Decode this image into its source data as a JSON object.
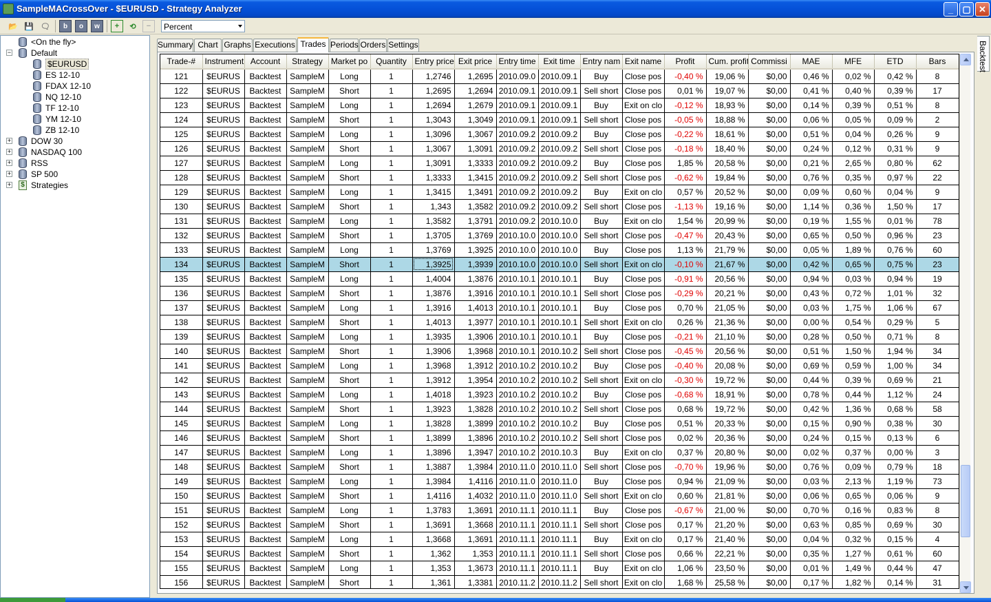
{
  "window": {
    "title": "SampleMACrossOver - $EURUSD - Strategy Analyzer",
    "minimize": "_",
    "maximize": "▢",
    "close": "✕"
  },
  "toolbar": {
    "display_unit": "Percent",
    "buttons": [
      "open-icon",
      "save-icon",
      "chat-icon",
      "b",
      "o",
      "w",
      "add-icon",
      "refresh-icon",
      "remove-icon"
    ]
  },
  "tree": {
    "items": [
      {
        "label": "<On the fly>",
        "indent": 1,
        "expander": "",
        "icon": "database-icon"
      },
      {
        "label": "Default",
        "indent": 0,
        "expander": "−",
        "icon": "database-icon"
      },
      {
        "label": "$EURUSD",
        "indent": 2,
        "expander": "",
        "icon": "database-icon",
        "selected": true
      },
      {
        "label": "ES 12-10",
        "indent": 2,
        "expander": "",
        "icon": "database-icon"
      },
      {
        "label": "FDAX 12-10",
        "indent": 2,
        "expander": "",
        "icon": "database-icon"
      },
      {
        "label": "NQ 12-10",
        "indent": 2,
        "expander": "",
        "icon": "database-icon"
      },
      {
        "label": "TF 12-10",
        "indent": 2,
        "expander": "",
        "icon": "database-icon"
      },
      {
        "label": "YM 12-10",
        "indent": 2,
        "expander": "",
        "icon": "database-icon"
      },
      {
        "label": "ZB 12-10",
        "indent": 2,
        "expander": "",
        "icon": "database-icon"
      },
      {
        "label": "DOW 30",
        "indent": 0,
        "expander": "+",
        "icon": "database-icon"
      },
      {
        "label": "NASDAQ 100",
        "indent": 0,
        "expander": "+",
        "icon": "database-icon"
      },
      {
        "label": "RSS",
        "indent": 0,
        "expander": "+",
        "icon": "database-icon"
      },
      {
        "label": "SP 500",
        "indent": 0,
        "expander": "+",
        "icon": "database-icon"
      },
      {
        "label": "Strategies",
        "indent": 0,
        "expander": "+",
        "icon": "strategy-icon"
      }
    ]
  },
  "tabs": [
    "Summary",
    "Chart",
    "Graphs",
    "Executions",
    "Trades",
    "Periods",
    "Orders",
    "Settings"
  ],
  "active_tab": "Trades",
  "side_tab": "Backtest",
  "grid": {
    "columns": [
      "Trade-#",
      "Instrument",
      "Account",
      "Strategy",
      "Market po",
      "Quantity",
      "Entry price",
      "Exit price",
      "Entry time",
      "Exit time",
      "Entry nam",
      "Exit name",
      "Profit",
      "Cum. profit",
      "Commissi",
      "MAE",
      "MFE",
      "ETD",
      "Bars"
    ],
    "selected_trade": "134",
    "rows": [
      [
        "121",
        "$EURUS",
        "Backtest",
        "SampleM",
        "Long",
        "1",
        "1,2746",
        "1,2695",
        "2010.09.0",
        "2010.09.1",
        "Buy",
        "Close pos",
        "-0,40 %",
        "19,06 %",
        "$0,00",
        "0,46 %",
        "0,02 %",
        "0,42 %",
        "8"
      ],
      [
        "122",
        "$EURUS",
        "Backtest",
        "SampleM",
        "Short",
        "1",
        "1,2695",
        "1,2694",
        "2010.09.1",
        "2010.09.1",
        "Sell short",
        "Close pos",
        "0,01 %",
        "19,07 %",
        "$0,00",
        "0,41 %",
        "0,40 %",
        "0,39 %",
        "17"
      ],
      [
        "123",
        "$EURUS",
        "Backtest",
        "SampleM",
        "Long",
        "1",
        "1,2694",
        "1,2679",
        "2010.09.1",
        "2010.09.1",
        "Buy",
        "Exit on clo",
        "-0,12 %",
        "18,93 %",
        "$0,00",
        "0,14 %",
        "0,39 %",
        "0,51 %",
        "8"
      ],
      [
        "124",
        "$EURUS",
        "Backtest",
        "SampleM",
        "Short",
        "1",
        "1,3043",
        "1,3049",
        "2010.09.1",
        "2010.09.1",
        "Sell short",
        "Close pos",
        "-0,05 %",
        "18,88 %",
        "$0,00",
        "0,06 %",
        "0,05 %",
        "0,09 %",
        "2"
      ],
      [
        "125",
        "$EURUS",
        "Backtest",
        "SampleM",
        "Long",
        "1",
        "1,3096",
        "1,3067",
        "2010.09.2",
        "2010.09.2",
        "Buy",
        "Close pos",
        "-0,22 %",
        "18,61 %",
        "$0,00",
        "0,51 %",
        "0,04 %",
        "0,26 %",
        "9"
      ],
      [
        "126",
        "$EURUS",
        "Backtest",
        "SampleM",
        "Short",
        "1",
        "1,3067",
        "1,3091",
        "2010.09.2",
        "2010.09.2",
        "Sell short",
        "Close pos",
        "-0,18 %",
        "18,40 %",
        "$0,00",
        "0,24 %",
        "0,12 %",
        "0,31 %",
        "9"
      ],
      [
        "127",
        "$EURUS",
        "Backtest",
        "SampleM",
        "Long",
        "1",
        "1,3091",
        "1,3333",
        "2010.09.2",
        "2010.09.2",
        "Buy",
        "Close pos",
        "1,85 %",
        "20,58 %",
        "$0,00",
        "0,21 %",
        "2,65 %",
        "0,80 %",
        "62"
      ],
      [
        "128",
        "$EURUS",
        "Backtest",
        "SampleM",
        "Short",
        "1",
        "1,3333",
        "1,3415",
        "2010.09.2",
        "2010.09.2",
        "Sell short",
        "Close pos",
        "-0,62 %",
        "19,84 %",
        "$0,00",
        "0,76 %",
        "0,35 %",
        "0,97 %",
        "22"
      ],
      [
        "129",
        "$EURUS",
        "Backtest",
        "SampleM",
        "Long",
        "1",
        "1,3415",
        "1,3491",
        "2010.09.2",
        "2010.09.2",
        "Buy",
        "Exit on clo",
        "0,57 %",
        "20,52 %",
        "$0,00",
        "0,09 %",
        "0,60 %",
        "0,04 %",
        "9"
      ],
      [
        "130",
        "$EURUS",
        "Backtest",
        "SampleM",
        "Short",
        "1",
        "1,343",
        "1,3582",
        "2010.09.2",
        "2010.09.2",
        "Sell short",
        "Close pos",
        "-1,13 %",
        "19,16 %",
        "$0,00",
        "1,14 %",
        "0,36 %",
        "1,50 %",
        "17"
      ],
      [
        "131",
        "$EURUS",
        "Backtest",
        "SampleM",
        "Long",
        "1",
        "1,3582",
        "1,3791",
        "2010.09.2",
        "2010.10.0",
        "Buy",
        "Exit on clo",
        "1,54 %",
        "20,99 %",
        "$0,00",
        "0,19 %",
        "1,55 %",
        "0,01 %",
        "78"
      ],
      [
        "132",
        "$EURUS",
        "Backtest",
        "SampleM",
        "Short",
        "1",
        "1,3705",
        "1,3769",
        "2010.10.0",
        "2010.10.0",
        "Sell short",
        "Close pos",
        "-0,47 %",
        "20,43 %",
        "$0,00",
        "0,65 %",
        "0,50 %",
        "0,96 %",
        "23"
      ],
      [
        "133",
        "$EURUS",
        "Backtest",
        "SampleM",
        "Long",
        "1",
        "1,3769",
        "1,3925",
        "2010.10.0",
        "2010.10.0",
        "Buy",
        "Close pos",
        "1,13 %",
        "21,79 %",
        "$0,00",
        "0,05 %",
        "1,89 %",
        "0,76 %",
        "60"
      ],
      [
        "134",
        "$EURUS",
        "Backtest",
        "SampleM",
        "Short",
        "1",
        "1,3925",
        "1,3939",
        "2010.10.0",
        "2010.10.0",
        "Sell short",
        "Exit on clo",
        "-0,10 %",
        "21,67 %",
        "$0,00",
        "0,42 %",
        "0,65 %",
        "0,75 %",
        "23"
      ],
      [
        "135",
        "$EURUS",
        "Backtest",
        "SampleM",
        "Long",
        "1",
        "1,4004",
        "1,3876",
        "2010.10.1",
        "2010.10.1",
        "Buy",
        "Close pos",
        "-0,91 %",
        "20,56 %",
        "$0,00",
        "0,94 %",
        "0,03 %",
        "0,94 %",
        "19"
      ],
      [
        "136",
        "$EURUS",
        "Backtest",
        "SampleM",
        "Short",
        "1",
        "1,3876",
        "1,3916",
        "2010.10.1",
        "2010.10.1",
        "Sell short",
        "Close pos",
        "-0,29 %",
        "20,21 %",
        "$0,00",
        "0,43 %",
        "0,72 %",
        "1,01 %",
        "32"
      ],
      [
        "137",
        "$EURUS",
        "Backtest",
        "SampleM",
        "Long",
        "1",
        "1,3916",
        "1,4013",
        "2010.10.1",
        "2010.10.1",
        "Buy",
        "Close pos",
        "0,70 %",
        "21,05 %",
        "$0,00",
        "0,03 %",
        "1,75 %",
        "1,06 %",
        "67"
      ],
      [
        "138",
        "$EURUS",
        "Backtest",
        "SampleM",
        "Short",
        "1",
        "1,4013",
        "1,3977",
        "2010.10.1",
        "2010.10.1",
        "Sell short",
        "Exit on clo",
        "0,26 %",
        "21,36 %",
        "$0,00",
        "0,00 %",
        "0,54 %",
        "0,29 %",
        "5"
      ],
      [
        "139",
        "$EURUS",
        "Backtest",
        "SampleM",
        "Long",
        "1",
        "1,3935",
        "1,3906",
        "2010.10.1",
        "2010.10.1",
        "Buy",
        "Close pos",
        "-0,21 %",
        "21,10 %",
        "$0,00",
        "0,28 %",
        "0,50 %",
        "0,71 %",
        "8"
      ],
      [
        "140",
        "$EURUS",
        "Backtest",
        "SampleM",
        "Short",
        "1",
        "1,3906",
        "1,3968",
        "2010.10.1",
        "2010.10.2",
        "Sell short",
        "Close pos",
        "-0,45 %",
        "20,56 %",
        "$0,00",
        "0,51 %",
        "1,50 %",
        "1,94 %",
        "34"
      ],
      [
        "141",
        "$EURUS",
        "Backtest",
        "SampleM",
        "Long",
        "1",
        "1,3968",
        "1,3912",
        "2010.10.2",
        "2010.10.2",
        "Buy",
        "Close pos",
        "-0,40 %",
        "20,08 %",
        "$0,00",
        "0,69 %",
        "0,59 %",
        "1,00 %",
        "34"
      ],
      [
        "142",
        "$EURUS",
        "Backtest",
        "SampleM",
        "Short",
        "1",
        "1,3912",
        "1,3954",
        "2010.10.2",
        "2010.10.2",
        "Sell short",
        "Exit on clo",
        "-0,30 %",
        "19,72 %",
        "$0,00",
        "0,44 %",
        "0,39 %",
        "0,69 %",
        "21"
      ],
      [
        "143",
        "$EURUS",
        "Backtest",
        "SampleM",
        "Long",
        "1",
        "1,4018",
        "1,3923",
        "2010.10.2",
        "2010.10.2",
        "Buy",
        "Close pos",
        "-0,68 %",
        "18,91 %",
        "$0,00",
        "0,78 %",
        "0,44 %",
        "1,12 %",
        "24"
      ],
      [
        "144",
        "$EURUS",
        "Backtest",
        "SampleM",
        "Short",
        "1",
        "1,3923",
        "1,3828",
        "2010.10.2",
        "2010.10.2",
        "Sell short",
        "Close pos",
        "0,68 %",
        "19,72 %",
        "$0,00",
        "0,42 %",
        "1,36 %",
        "0,68 %",
        "58"
      ],
      [
        "145",
        "$EURUS",
        "Backtest",
        "SampleM",
        "Long",
        "1",
        "1,3828",
        "1,3899",
        "2010.10.2",
        "2010.10.2",
        "Buy",
        "Close pos",
        "0,51 %",
        "20,33 %",
        "$0,00",
        "0,15 %",
        "0,90 %",
        "0,38 %",
        "30"
      ],
      [
        "146",
        "$EURUS",
        "Backtest",
        "SampleM",
        "Short",
        "1",
        "1,3899",
        "1,3896",
        "2010.10.2",
        "2010.10.2",
        "Sell short",
        "Close pos",
        "0,02 %",
        "20,36 %",
        "$0,00",
        "0,24 %",
        "0,15 %",
        "0,13 %",
        "6"
      ],
      [
        "147",
        "$EURUS",
        "Backtest",
        "SampleM",
        "Long",
        "1",
        "1,3896",
        "1,3947",
        "2010.10.2",
        "2010.10.3",
        "Buy",
        "Exit on clo",
        "0,37 %",
        "20,80 %",
        "$0,00",
        "0,02 %",
        "0,37 %",
        "0,00 %",
        "3"
      ],
      [
        "148",
        "$EURUS",
        "Backtest",
        "SampleM",
        "Short",
        "1",
        "1,3887",
        "1,3984",
        "2010.11.0",
        "2010.11.0",
        "Sell short",
        "Close pos",
        "-0,70 %",
        "19,96 %",
        "$0,00",
        "0,76 %",
        "0,09 %",
        "0,79 %",
        "18"
      ],
      [
        "149",
        "$EURUS",
        "Backtest",
        "SampleM",
        "Long",
        "1",
        "1,3984",
        "1,4116",
        "2010.11.0",
        "2010.11.0",
        "Buy",
        "Close pos",
        "0,94 %",
        "21,09 %",
        "$0,00",
        "0,03 %",
        "2,13 %",
        "1,19 %",
        "73"
      ],
      [
        "150",
        "$EURUS",
        "Backtest",
        "SampleM",
        "Short",
        "1",
        "1,4116",
        "1,4032",
        "2010.11.0",
        "2010.11.0",
        "Sell short",
        "Exit on clo",
        "0,60 %",
        "21,81 %",
        "$0,00",
        "0,06 %",
        "0,65 %",
        "0,06 %",
        "9"
      ],
      [
        "151",
        "$EURUS",
        "Backtest",
        "SampleM",
        "Long",
        "1",
        "1,3783",
        "1,3691",
        "2010.11.1",
        "2010.11.1",
        "Buy",
        "Close pos",
        "-0,67 %",
        "21,00 %",
        "$0,00",
        "0,70 %",
        "0,16 %",
        "0,83 %",
        "8"
      ],
      [
        "152",
        "$EURUS",
        "Backtest",
        "SampleM",
        "Short",
        "1",
        "1,3691",
        "1,3668",
        "2010.11.1",
        "2010.11.1",
        "Sell short",
        "Close pos",
        "0,17 %",
        "21,20 %",
        "$0,00",
        "0,63 %",
        "0,85 %",
        "0,69 %",
        "30"
      ],
      [
        "153",
        "$EURUS",
        "Backtest",
        "SampleM",
        "Long",
        "1",
        "1,3668",
        "1,3691",
        "2010.11.1",
        "2010.11.1",
        "Buy",
        "Exit on clo",
        "0,17 %",
        "21,40 %",
        "$0,00",
        "0,04 %",
        "0,32 %",
        "0,15 %",
        "4"
      ],
      [
        "154",
        "$EURUS",
        "Backtest",
        "SampleM",
        "Short",
        "1",
        "1,362",
        "1,353",
        "2010.11.1",
        "2010.11.1",
        "Sell short",
        "Close pos",
        "0,66 %",
        "22,21 %",
        "$0,00",
        "0,35 %",
        "1,27 %",
        "0,61 %",
        "60"
      ],
      [
        "155",
        "$EURUS",
        "Backtest",
        "SampleM",
        "Long",
        "1",
        "1,353",
        "1,3673",
        "2010.11.1",
        "2010.11.1",
        "Buy",
        "Exit on clo",
        "1,06 %",
        "23,50 %",
        "$0,00",
        "0,01 %",
        "1,49 %",
        "0,44 %",
        "47"
      ],
      [
        "156",
        "$EURUS",
        "Backtest",
        "SampleM",
        "Short",
        "1",
        "1,361",
        "1,3381",
        "2010.11.2",
        "2010.11.2",
        "Sell short",
        "Exit on clo",
        "1,68 %",
        "25,58 %",
        "$0,00",
        "0,17 %",
        "1,82 %",
        "0,14 %",
        "31"
      ]
    ]
  },
  "scrollbar": {
    "position": 0.9,
    "visible_fraction": 0.14
  },
  "colors": {
    "negative": "#e00000",
    "selected_row": "#add8e6",
    "title_bar": "#0551d8"
  }
}
